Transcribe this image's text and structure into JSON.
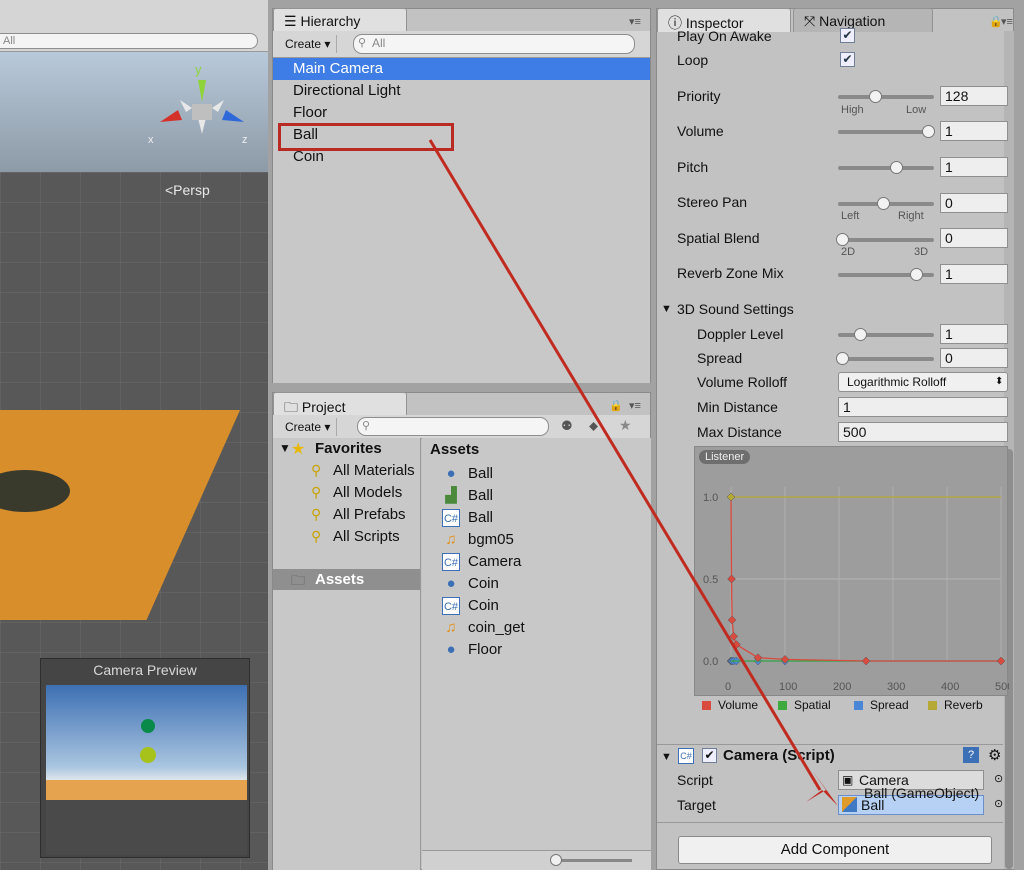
{
  "scene": {
    "search_placeholder": "All",
    "persp_label": "<Persp",
    "axis_y": "y",
    "axis_x": "x",
    "axis_z": "z",
    "camera_preview_title": "Camera Preview"
  },
  "hierarchy": {
    "tab_label": "Hierarchy",
    "create_label": "Create",
    "search_placeholder": "All",
    "items": [
      "Main Camera",
      "Directional Light",
      "Floor",
      "Ball",
      "Coin"
    ]
  },
  "project": {
    "tab_label": "Project",
    "create_label": "Create",
    "favorites_label": "Favorites",
    "favorites": [
      "All Materials",
      "All Models",
      "All Prefabs",
      "All Scripts"
    ],
    "assets_folder": "Assets",
    "assets_header": "Assets",
    "assets": [
      "Ball",
      "Ball",
      "Ball",
      "bgm05",
      "Camera",
      "Coin",
      "Coin",
      "coin_get",
      "Floor"
    ]
  },
  "inspector": {
    "tab_label": "Inspector",
    "nav_tab_label": "Navigation",
    "play_on_awake": "Play On Awake",
    "loop": "Loop",
    "priority": {
      "label": "Priority",
      "value": "128",
      "left": "High",
      "right": "Low",
      "level": 0.37
    },
    "volume": {
      "label": "Volume",
      "value": "1",
      "level": 0.95
    },
    "pitch": {
      "label": "Pitch",
      "value": "1",
      "level": 0.6
    },
    "stereo_pan": {
      "label": "Stereo Pan",
      "value": "0",
      "left": "Left",
      "right": "Right",
      "level": 0.45
    },
    "spatial_blend": {
      "label": "Spatial Blend",
      "value": "0",
      "left": "2D",
      "right": "3D",
      "level": 0.0
    },
    "reverb_zone_mix": {
      "label": "Reverb Zone Mix",
      "value": "1",
      "level": 0.82
    },
    "sound3d_header": "3D Sound Settings",
    "doppler": {
      "label": "Doppler Level",
      "value": "1",
      "level": 0.2
    },
    "spread": {
      "label": "Spread",
      "value": "0",
      "level": 0.0
    },
    "volume_rolloff": {
      "label": "Volume Rolloff",
      "value": "Logarithmic Rolloff"
    },
    "min_distance": {
      "label": "Min Distance",
      "value": "1"
    },
    "max_distance": {
      "label": "Max Distance",
      "value": "500"
    },
    "graph": {
      "listener": "Listener",
      "y_ticks": [
        "1.0",
        "0.5",
        "0.0"
      ],
      "x_ticks": [
        "0",
        "100",
        "200",
        "300",
        "400",
        "500"
      ],
      "legend": [
        "Volume",
        "Spatial",
        "Spread",
        "Reverb"
      ],
      "colors": {
        "volume": "#d94b3f",
        "spatial": "#3ea93e",
        "spread": "#4a86d6",
        "reverb": "#b5a834"
      }
    },
    "component_title": "Camera (Script)",
    "script_label": "Script",
    "script_value": "Camera",
    "target_label": "Target",
    "target_value": "Ball",
    "drag_tooltip": "Ball (GameObject)",
    "add_component": "Add Component"
  },
  "chart_data": {
    "type": "line",
    "x": [
      0,
      1,
      2,
      5,
      10,
      50,
      100,
      250,
      500
    ],
    "series": [
      {
        "name": "Volume",
        "values": [
          1.0,
          0.5,
          0.25,
          0.15,
          0.1,
          0.02,
          0.01,
          0.0,
          0.0
        ]
      },
      {
        "name": "Spatial",
        "values": [
          0,
          0,
          0,
          0,
          0,
          0,
          0,
          0,
          0
        ]
      },
      {
        "name": "Spread",
        "values": [
          0,
          0,
          0,
          0,
          0,
          0,
          0,
          0,
          0
        ]
      },
      {
        "name": "Reverb",
        "values": [
          1,
          1,
          1,
          1,
          1,
          1,
          1,
          1,
          1
        ]
      }
    ],
    "xlim": [
      0,
      500
    ],
    "ylim": [
      0,
      1
    ]
  }
}
